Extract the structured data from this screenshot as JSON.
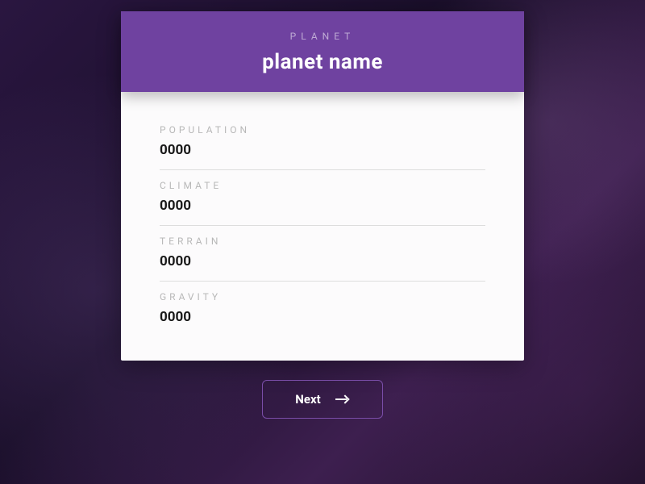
{
  "header": {
    "eyebrow": "PLANET",
    "title": "planet name"
  },
  "fields": {
    "population": {
      "label": "POPULATION",
      "value": "0000"
    },
    "climate": {
      "label": "CLIMATE",
      "value": "0000"
    },
    "terrain": {
      "label": "TERRAIN",
      "value": "0000"
    },
    "gravity": {
      "label": "GRAVITY",
      "value": "0000"
    }
  },
  "nav": {
    "next_label": "Next"
  }
}
